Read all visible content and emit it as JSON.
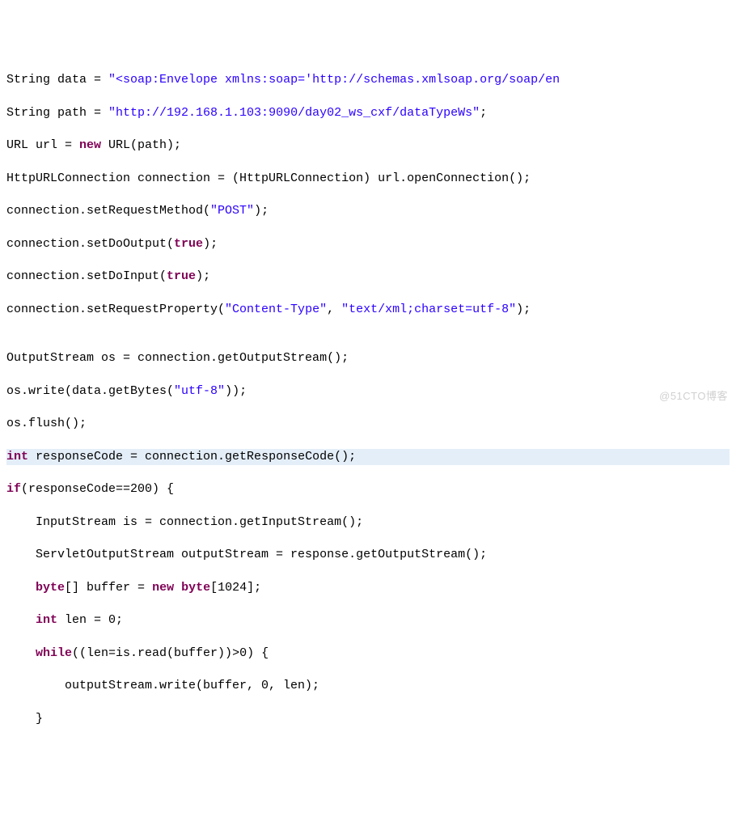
{
  "colors": {
    "keyword": "#7f0055",
    "string": "#2a00ff",
    "default": "#000000",
    "highlight_bg": "#e4eef8"
  },
  "highlight_line_index": 11,
  "watermark": "@51CTO博客",
  "lines": [
    [
      {
        "t": "String data = ",
        "c": "def"
      },
      {
        "t": "\"<soap:Envelope xmlns:soap='http://schemas.xmlsoap.org/soap/en",
        "c": "str"
      }
    ],
    [
      {
        "t": "String path = ",
        "c": "def"
      },
      {
        "t": "\"http://192.168.1.103:9090/day02_ws_cxf/dataTypeWs\"",
        "c": "str"
      },
      {
        "t": ";",
        "c": "def"
      }
    ],
    [
      {
        "t": "URL url = ",
        "c": "def"
      },
      {
        "t": "new",
        "c": "kw"
      },
      {
        "t": " URL(path);",
        "c": "def"
      }
    ],
    [
      {
        "t": "HttpURLConnection connection = (HttpURLConnection) url.openConnection();",
        "c": "def"
      }
    ],
    [
      {
        "t": "connection.setRequestMethod(",
        "c": "def"
      },
      {
        "t": "\"POST\"",
        "c": "str"
      },
      {
        "t": ");",
        "c": "def"
      }
    ],
    [
      {
        "t": "connection.setDoOutput(",
        "c": "def"
      },
      {
        "t": "true",
        "c": "kw"
      },
      {
        "t": ");",
        "c": "def"
      }
    ],
    [
      {
        "t": "connection.setDoInput(",
        "c": "def"
      },
      {
        "t": "true",
        "c": "kw"
      },
      {
        "t": ");",
        "c": "def"
      }
    ],
    [
      {
        "t": "connection.setRequestProperty(",
        "c": "def"
      },
      {
        "t": "\"Content-Type\"",
        "c": "str"
      },
      {
        "t": ", ",
        "c": "def"
      },
      {
        "t": "\"text/xml;charset=utf-8\"",
        "c": "str"
      },
      {
        "t": ");",
        "c": "def"
      }
    ],
    [
      {
        "t": "",
        "c": "def"
      }
    ],
    [
      {
        "t": "OutputStream os = connection.getOutputStream();",
        "c": "def"
      }
    ],
    [
      {
        "t": "os.write(data.getBytes(",
        "c": "def"
      },
      {
        "t": "\"utf-8\"",
        "c": "str"
      },
      {
        "t": "));",
        "c": "def"
      }
    ],
    [
      {
        "t": "os.flush();",
        "c": "def"
      }
    ],
    [
      {
        "t": "int",
        "c": "kw"
      },
      {
        "t": " responseCode = connection.getResponseCode();",
        "c": "def"
      }
    ],
    [
      {
        "t": "if",
        "c": "kw"
      },
      {
        "t": "(responseCode==200) {",
        "c": "def"
      }
    ],
    [
      {
        "t": "    InputStream is = connection.getInputStream();",
        "c": "def"
      }
    ],
    [
      {
        "t": "    ServletOutputStream outputStream = response.getOutputStream();",
        "c": "def"
      }
    ],
    [
      {
        "t": "    ",
        "c": "def"
      },
      {
        "t": "byte",
        "c": "kw"
      },
      {
        "t": "[] buffer = ",
        "c": "def"
      },
      {
        "t": "new",
        "c": "kw"
      },
      {
        "t": " ",
        "c": "def"
      },
      {
        "t": "byte",
        "c": "kw"
      },
      {
        "t": "[1024];",
        "c": "def"
      }
    ],
    [
      {
        "t": "    ",
        "c": "def"
      },
      {
        "t": "int",
        "c": "kw"
      },
      {
        "t": " len = 0;",
        "c": "def"
      }
    ],
    [
      {
        "t": "    ",
        "c": "def"
      },
      {
        "t": "while",
        "c": "kw"
      },
      {
        "t": "((len=is.read(buffer))>0) {",
        "c": "def"
      }
    ],
    [
      {
        "t": "        outputStream.write(buffer, 0, len);",
        "c": "def"
      }
    ],
    [
      {
        "t": "    }",
        "c": "def"
      }
    ]
  ]
}
